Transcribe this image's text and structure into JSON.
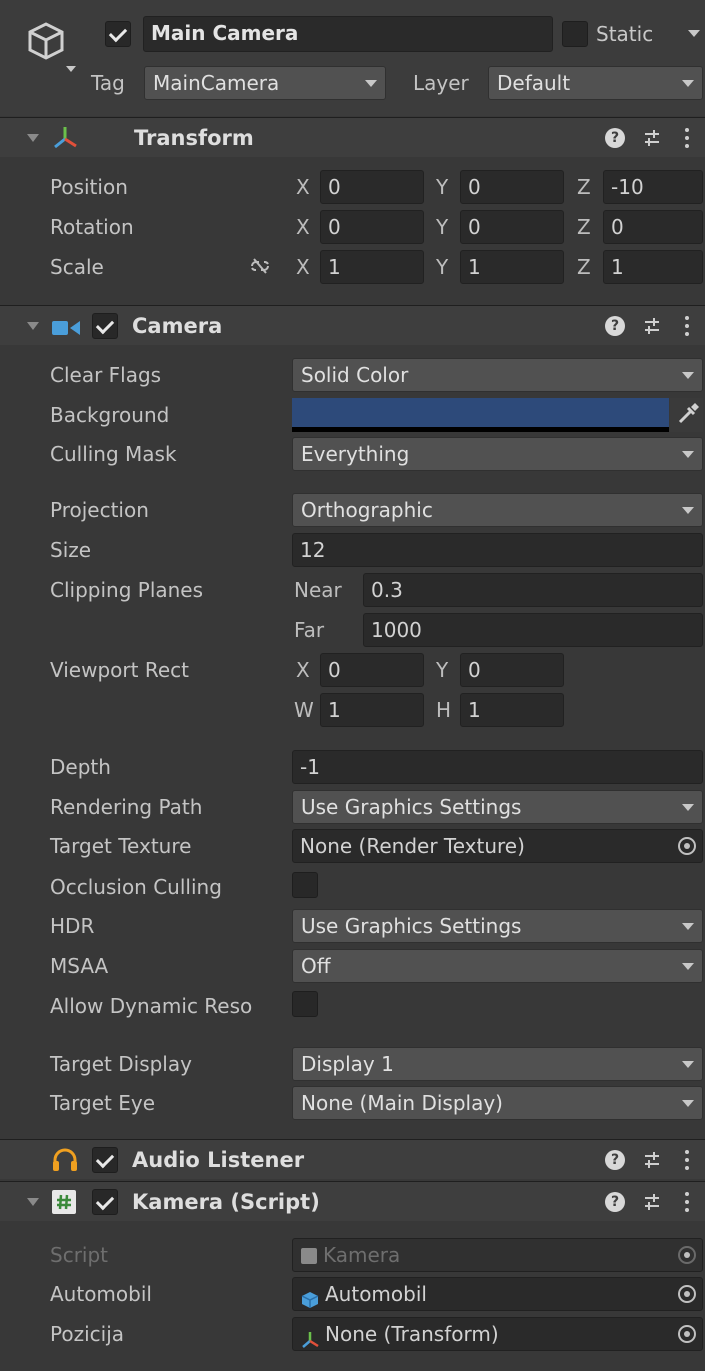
{
  "gameobject": {
    "active": true,
    "name": "Main Camera",
    "static_label": "Static",
    "static": false,
    "tag_label": "Tag",
    "tag_value": "MainCamera",
    "layer_label": "Layer",
    "layer_value": "Default"
  },
  "transform": {
    "title": "Transform",
    "rows": [
      {
        "label": "Position",
        "x": "0",
        "y": "0",
        "z": "-10"
      },
      {
        "label": "Rotation",
        "x": "0",
        "y": "0",
        "z": "0"
      },
      {
        "label": "Scale",
        "x": "1",
        "y": "1",
        "z": "1"
      }
    ],
    "axis_x": "X",
    "axis_y": "Y",
    "axis_z": "Z"
  },
  "camera": {
    "title": "Camera",
    "enabled": true,
    "clear_flags": {
      "label": "Clear Flags",
      "value": "Solid Color"
    },
    "background": {
      "label": "Background",
      "color": "#2d4a7a"
    },
    "culling_mask": {
      "label": "Culling Mask",
      "value": "Everything"
    },
    "projection": {
      "label": "Projection",
      "value": "Orthographic"
    },
    "size": {
      "label": "Size",
      "value": "12"
    },
    "clipping": {
      "label": "Clipping Planes",
      "near_label": "Near",
      "near": "0.3",
      "far_label": "Far",
      "far": "1000"
    },
    "viewport": {
      "label": "Viewport Rect",
      "x_label": "X",
      "x": "0",
      "y_label": "Y",
      "y": "0",
      "w_label": "W",
      "w": "1",
      "h_label": "H",
      "h": "1"
    },
    "depth": {
      "label": "Depth",
      "value": "-1"
    },
    "rendering_path": {
      "label": "Rendering Path",
      "value": "Use Graphics Settings"
    },
    "target_texture": {
      "label": "Target Texture",
      "value": "None (Render Texture)"
    },
    "occlusion": {
      "label": "Occlusion Culling",
      "checked": false
    },
    "hdr": {
      "label": "HDR",
      "value": "Use Graphics Settings"
    },
    "msaa": {
      "label": "MSAA",
      "value": "Off"
    },
    "dynamic_res": {
      "label": "Allow Dynamic Reso",
      "checked": false
    },
    "target_display": {
      "label": "Target Display",
      "value": "Display 1"
    },
    "target_eye": {
      "label": "Target Eye",
      "value": "None (Main Display)"
    }
  },
  "audio_listener": {
    "title": "Audio Listener",
    "enabled": true
  },
  "kamera_script": {
    "title": "Kamera (Script)",
    "enabled": true,
    "script": {
      "label": "Script",
      "value": "Kamera"
    },
    "automobil": {
      "label": "Automobil",
      "value": "Automobil"
    },
    "pozicija": {
      "label": "Pozicija",
      "value": "None (Transform)"
    }
  },
  "colors": {
    "panel": "#383838",
    "header": "#3e3e3e",
    "field": "#2a2a2a",
    "dropdown": "#515151",
    "accent_blue": "#4a9eda"
  }
}
